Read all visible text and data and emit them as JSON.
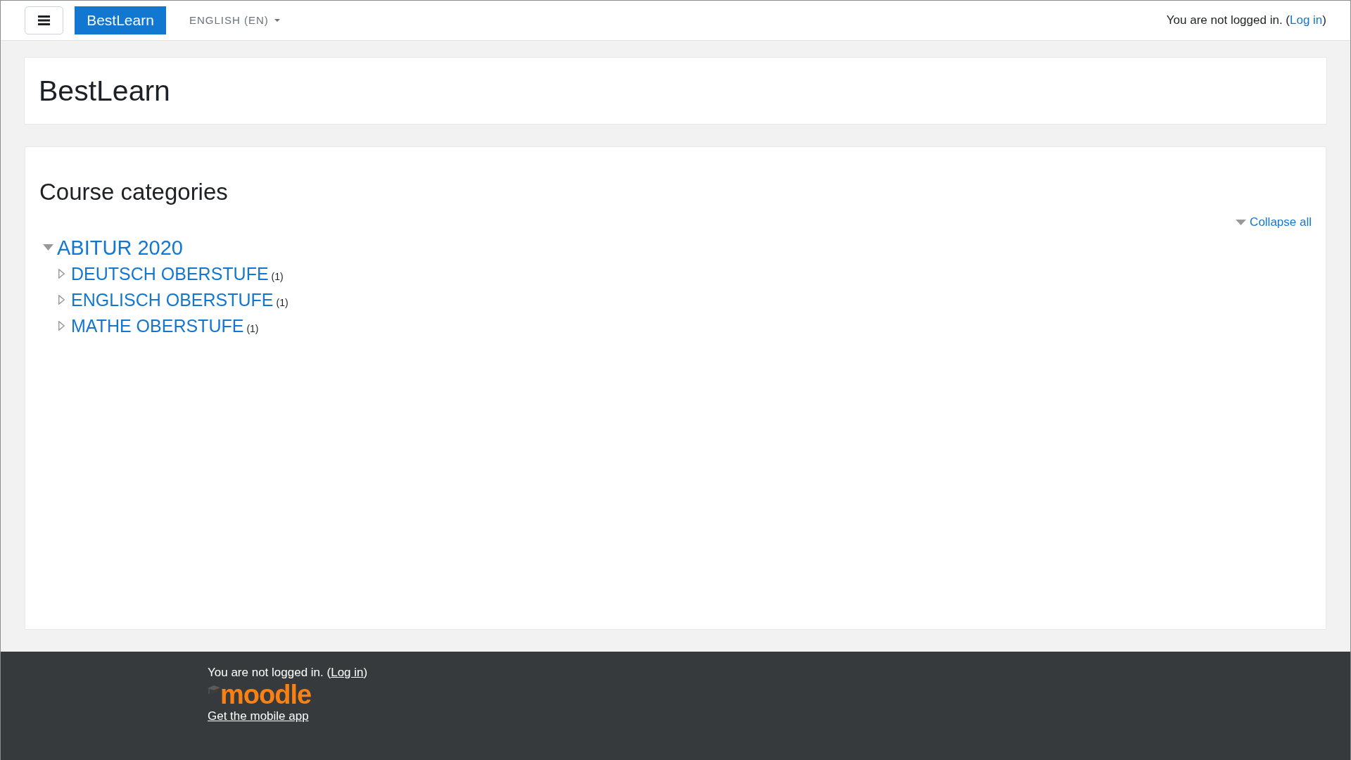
{
  "navbar": {
    "brand": "BestLearn",
    "language": "ENGLISH (EN)",
    "login_notice": {
      "before": "You are not logged in. (",
      "link": "Log in",
      "after": ")"
    }
  },
  "page_header": {
    "title": "BestLearn"
  },
  "course_categories": {
    "heading": "Course categories",
    "collapse_all": "Collapse all",
    "tree": [
      {
        "name": "ABITUR 2020",
        "expanded": true,
        "children": [
          {
            "name": "DEUTSCH OBERSTUFE",
            "count": "(1)",
            "expanded": false
          },
          {
            "name": "ENGLISCH OBERSTUFE",
            "count": "(1)",
            "expanded": false
          },
          {
            "name": "MATHE OBERSTUFE",
            "count": "(1)",
            "expanded": false
          }
        ]
      }
    ]
  },
  "footer": {
    "login_notice": {
      "before": "You are not logged in. (",
      "link": "Log in",
      "after": ")"
    },
    "logo": "moodle",
    "mobile_app_link": "Get the mobile app"
  }
}
